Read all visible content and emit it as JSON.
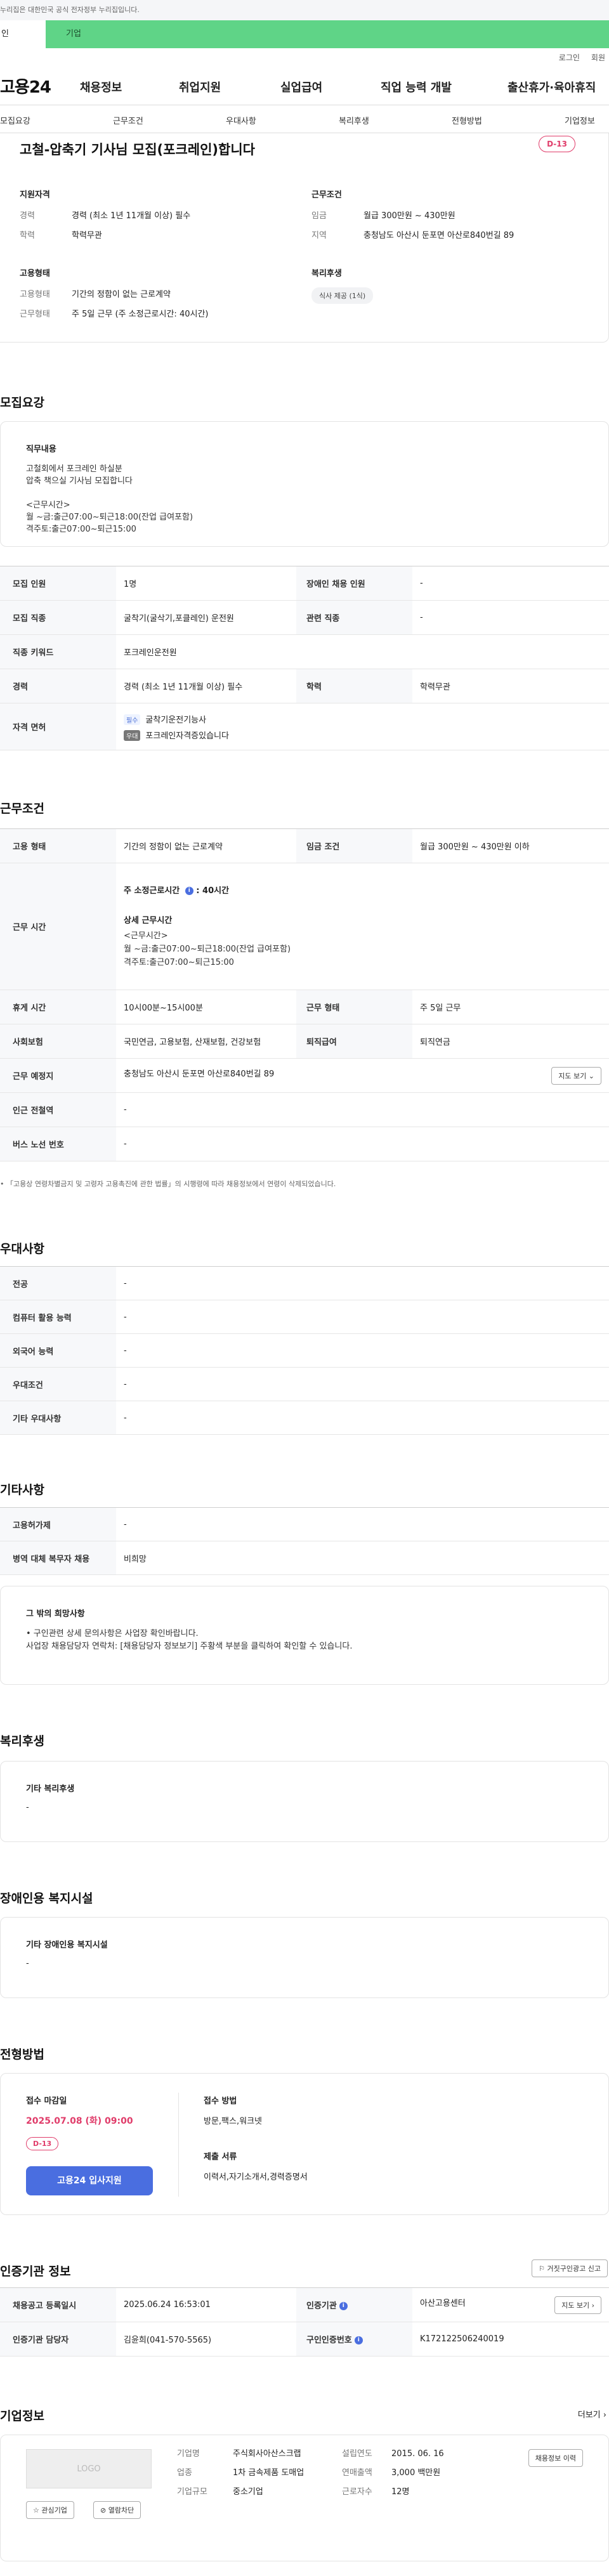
{
  "notice": "누리집은 대한민국 공식 전자정부 누리집입니다.",
  "user_tabs": {
    "person": "인",
    "company": "기업"
  },
  "util": {
    "login": "로그인",
    "join": "회원"
  },
  "gnb": {
    "logo": "고용24",
    "items": [
      "채용정보",
      "취업지원",
      "실업급여",
      "직업 능력 개발",
      "출산휴가·육아휴직"
    ]
  },
  "lnb": [
    "모집요강",
    "근무조건",
    "우대사항",
    "복리후생",
    "전형방법",
    "기업정보"
  ],
  "summary": {
    "title": "고철-압축기 기사님 모집(포크레인)합니다",
    "dday": "D-13",
    "qual": {
      "heading": "지원자격",
      "rows": [
        {
          "label": "경력",
          "value": "경력 (최소 1년 11개월 이상) 필수"
        },
        {
          "label": "학력",
          "value": "학력무관"
        }
      ]
    },
    "cond": {
      "heading": "근무조건",
      "rows": [
        {
          "label": "임금",
          "value": "월급 300만원 ~ 430만원"
        },
        {
          "label": "지역",
          "value": "충청남도 아산시 둔포면 아산로840번길 89"
        }
      ]
    },
    "emp": {
      "heading": "고용형태",
      "rows": [
        {
          "label": "고용형태",
          "value": "기간의 정함이 없는 근로계약"
        },
        {
          "label": "근무형태",
          "value": "주 5일 근무 (주 소정근로시간: 40시간)"
        }
      ]
    },
    "benefit": {
      "heading": "복리후생",
      "badge": "식사 제공 (1식)"
    }
  },
  "recruit": {
    "title": "모집요강",
    "duty_heading": "직무내용",
    "duty_text": "고철회에서 포크레인 하실분\n압축 책으실 기사님 모집합니다\n\n<근무시간>\n월 ~금:출근07:00~퇴근18:00(잔업 급여포함)\n격주토:출근07:00~퇴근15:00",
    "rows": [
      {
        "th": "모집 인원",
        "td": "1명",
        "th2": "장애인 채용 인원",
        "td2": "-"
      },
      {
        "th": "모집 직종",
        "td": "굴착기(굴삭기,포클레인) 운전원",
        "th2": "관련 직종",
        "td2": "-"
      },
      {
        "th": "직종 키워드",
        "td": "포크레인운전원"
      },
      {
        "th": "경력",
        "td": "경력 (최소 1년 11개월 이상) 필수",
        "th2": "학력",
        "td2": "학력무관"
      }
    ],
    "license_th": "자격 면허",
    "license_req_tag": "필수",
    "license_req": "굴착기운전기능사",
    "license_pref_tag": "우대",
    "license_pref": "포크레인자격증있습니다"
  },
  "work": {
    "title": "근무조건",
    "type_th": "고용 형태",
    "type_td": "기간의 정함이 없는 근로계약",
    "wage_th": "임금 조건",
    "wage_td": "월급 300만원 ~ 430만원 이하",
    "hours_th": "근무 시간",
    "hours_label": "주 소정근로시간",
    "hours_value": "40시간",
    "hours_detail_h": "상세 근무시간",
    "hours_detail": "<근무시간>\n월 ~금:출근07:00~퇴근18:00(잔업 급여포함)\n격주토:출근07:00~퇴근15:00",
    "rest_th": "휴게 시간",
    "rest_td": "10시00분~15시00분",
    "worktype_th": "근무 형태",
    "worktype_td": "주 5일 근무",
    "ins_th": "사회보험",
    "ins_td": "국민연금, 고용보험, 산재보험, 건강보험",
    "sev_th": "퇴직급여",
    "sev_td": "퇴직연금",
    "place_th": "근무 예정지",
    "place_td": "충청남도 아산시 둔포면 아산로840번길 89",
    "map_btn": "지도 보기",
    "subway_th": "인근 전철역",
    "subway_td": "-",
    "bus_th": "버스 노선 번호",
    "bus_td": "-",
    "note": "「고용상 연령차별금지 및 고령자 고용촉진에 관한 법률」의 시행령에 따라 채용정보에서 연령이 삭제되었습니다."
  },
  "pref": {
    "title": "우대사항",
    "rows": [
      {
        "th": "전공",
        "td": "-"
      },
      {
        "th": "컴퓨터 활용 능력",
        "td": "-"
      },
      {
        "th": "외국어 능력",
        "td": "-"
      },
      {
        "th": "우대조건",
        "td": "-"
      },
      {
        "th": "기타 우대사항",
        "td": "-"
      }
    ]
  },
  "etc": {
    "title": "기타사항",
    "rows": [
      {
        "th": "고용허가제",
        "td": "-"
      },
      {
        "th": "병역 대체 복무자 채용",
        "td": "비희망"
      }
    ],
    "box_h": "그 밖의 희망사항",
    "box_lines": [
      "• 구인관련 상세 문의사항은 사업장 확인바랍니다.",
      "사업장 채용담당자 연락처: [채용담당자 정보보기] 주황색 부분을 클릭하여 확인할 수 있습니다."
    ]
  },
  "welfare": {
    "title": "복리후생",
    "box_h": "기타 복리후생",
    "box_v": "-"
  },
  "disabled": {
    "title": "장애인용 복지시설",
    "box_h": "기타 장애인용 복지시설",
    "box_v": "-"
  },
  "process": {
    "title": "전형방법",
    "deadline_h": "접수 마감일",
    "deadline": "2025.07.08 (화) 09:00",
    "dday": "D-13",
    "apply_btn": "고용24 입사지원",
    "method_h": "접수 방법",
    "method": "방문,팩스,워크넷",
    "docs_h": "제출 서류",
    "docs": "이력서,자기소개서,경력증명서"
  },
  "cert": {
    "title": "인증기관 정보",
    "report_btn": "거짓구인광고 신고",
    "rows": [
      {
        "th": "채용공고 등록일시",
        "td": "2025.06.24 16:53:01",
        "th2": "인증기관",
        "td2": "아산고용센터",
        "btn": "지도 보기"
      },
      {
        "th": "인증기관 담당자",
        "td": "김윤희(041-570-5565)",
        "th2": "구인인증번호",
        "td2": "K172122506240019"
      }
    ]
  },
  "company": {
    "title": "기업정보",
    "more": "더보기",
    "logo": "LOGO",
    "fav": "관심기업",
    "block": "열람차단",
    "rows": [
      {
        "label": "기업명",
        "value": "주식회사아산스크랩"
      },
      {
        "label": "업종",
        "value": "1차 금속제품 도매업"
      },
      {
        "label": "기업규모",
        "value": "중소기업"
      }
    ],
    "rows2": [
      {
        "label": "설립연도",
        "value": "2015. 06. 16"
      },
      {
        "label": "연매출액",
        "value": "3,000 백만원"
      },
      {
        "label": "근로자수",
        "value": "12명"
      }
    ],
    "hire_btn": "채용정보 이력"
  }
}
